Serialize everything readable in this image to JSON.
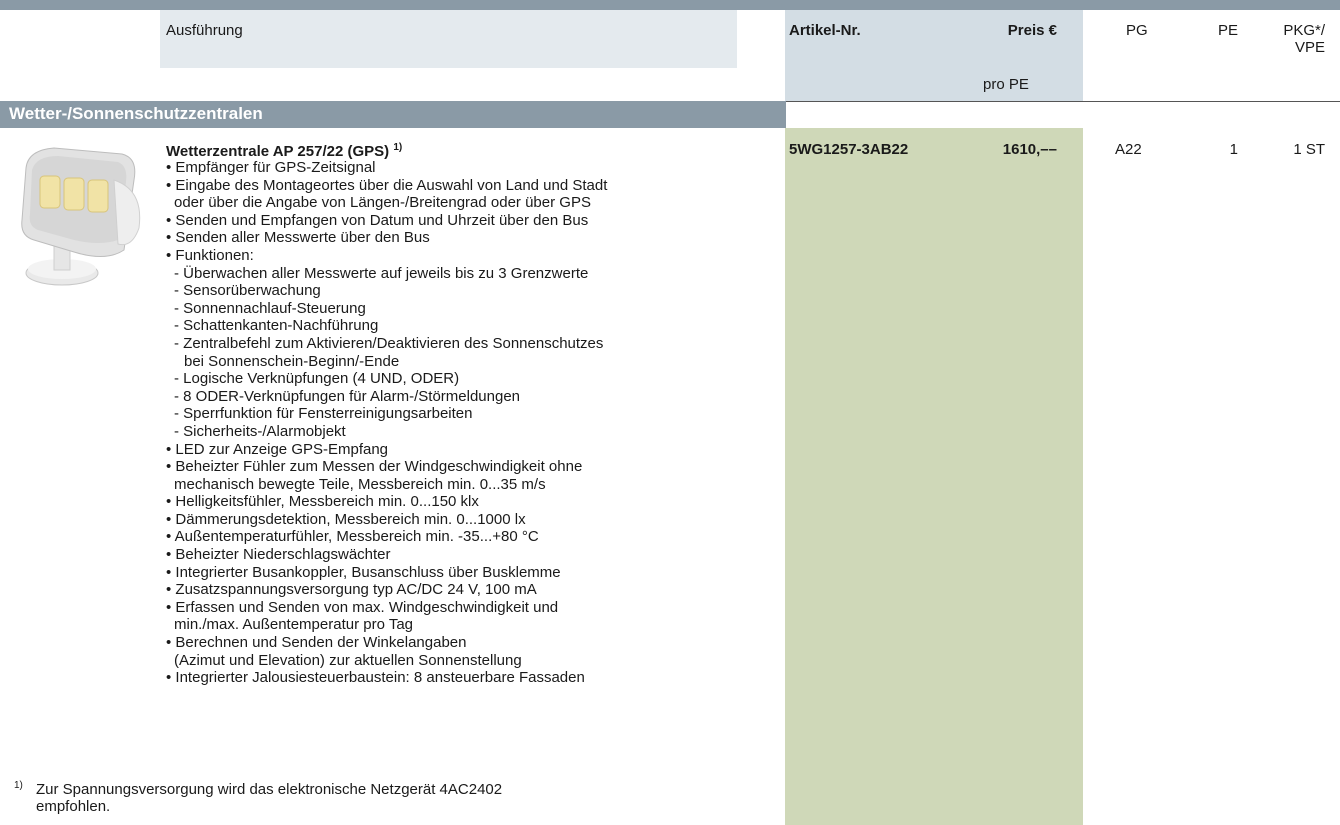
{
  "header": {
    "ausfuehrung": "Ausführung",
    "artikel_nr": "Artikel-Nr.",
    "preis": "Preis €",
    "pro_pe": "pro PE",
    "pg": "PG",
    "pe": "PE",
    "pkg_line1": "PKG*/",
    "pkg_line2": "VPE"
  },
  "section": {
    "title": "Wetter-/Sonnenschutzzentralen"
  },
  "product": {
    "title": "Wetterzentrale AP 257/22 (GPS)",
    "title_footnote": "1)",
    "artikel_nr": "5WG1257-3AB22",
    "preis": "1610,––",
    "pg": "A22",
    "pe": "1",
    "pkg": "1 ST",
    "features": [
      "• Empfänger für GPS-Zeitsignal",
      "• Eingabe des Montageortes über die Auswahl von Land und Stadt",
      "  oder über die Angabe von Längen-/Breitengrad oder über GPS",
      "• Senden und Empfangen von Datum und Uhrzeit über den Bus",
      "• Senden aller Messwerte über den Bus",
      "• Funktionen:",
      "  - Überwachen aller Messwerte auf jeweils bis zu 3 Grenzwerte",
      "  - Sensorüberwachung",
      "  - Sonnennachlauf-Steuerung",
      "  - Schattenkanten-Nachführung",
      "  - Zentralbefehl zum Aktivieren/Deaktivieren des Sonnenschutzes",
      "     bei Sonnenschein-Beginn/-Ende",
      "  - Logische Verknüpfungen (4 UND, ODER)",
      "  - 8 ODER-Verknüpfungen für Alarm-/Störmeldungen",
      "  - Sperrfunktion für Fensterreinigungsarbeiten",
      "  - Sicherheits-/Alarmobjekt",
      "• LED zur Anzeige GPS-Empfang",
      "• Beheizter Fühler zum Messen der Windgeschwindigkeit ohne",
      "  mechanisch bewegte Teile, Messbereich min. 0...35 m/s",
      "• Helligkeitsfühler, Messbereich min. 0...150 klx",
      "• Dämmerungsdetektion, Messbereich min. 0...1000 lx",
      "• Außentemperaturfühler, Messbereich min. -35...+80 °C",
      "• Beheizter Niederschlagswächter",
      "• Integrierter Busankoppler, Busanschluss über Busklemme",
      "• Zusatzspannungsversorgung typ AC/DC 24 V, 100 mA",
      "• Erfassen und Senden von max. Windgeschwindigkeit und",
      "  min./max. Außentemperatur pro Tag",
      "• Berechnen und Senden der Winkelangaben",
      "  (Azimut und Elevation) zur aktuellen Sonnenstellung",
      "• Integrierter Jalousiesteuerbaustein: 8 ansteuerbare Fassaden"
    ]
  },
  "footnote": {
    "marker": "1)",
    "line1": "Zur Spannungsversorgung wird das elektronische Netzgerät 4AC2402",
    "line2": "empfohlen."
  }
}
